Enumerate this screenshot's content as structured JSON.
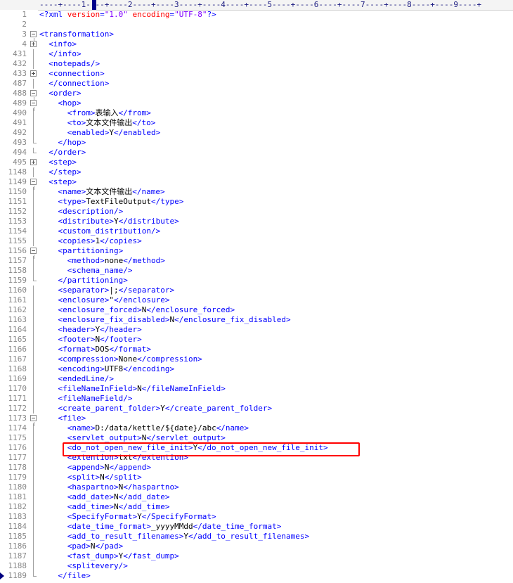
{
  "ruler": {
    "text": "----+----1----+----2----+----3----+----4----+----5----+----6----+----7----+----8----+----9----+"
  },
  "lines": [
    {
      "n": "1",
      "fold": "none",
      "indent": "",
      "tokens": [
        {
          "c": "t",
          "s": "<?xml "
        },
        {
          "c": "a",
          "s": "version"
        },
        {
          "c": "t",
          "s": "="
        },
        {
          "c": "v",
          "s": "\"1.0\""
        },
        {
          "c": "t",
          "s": " "
        },
        {
          "c": "a",
          "s": "encoding"
        },
        {
          "c": "t",
          "s": "="
        },
        {
          "c": "v",
          "s": "\"UTF-8\""
        },
        {
          "c": "t",
          "s": "?>"
        }
      ]
    },
    {
      "n": "2",
      "fold": "none",
      "indent": "",
      "tokens": []
    },
    {
      "n": "3",
      "fold": "minus",
      "indent": "",
      "tokens": [
        {
          "c": "t",
          "s": "<transformation>"
        }
      ]
    },
    {
      "n": "4",
      "fold": "plus",
      "indent": "  ",
      "tokens": [
        {
          "c": "t",
          "s": "<info>"
        }
      ]
    },
    {
      "n": "431",
      "fold": "vline",
      "indent": "  ",
      "tokens": [
        {
          "c": "t",
          "s": "</info>"
        }
      ]
    },
    {
      "n": "432",
      "fold": "vline",
      "indent": "  ",
      "tokens": [
        {
          "c": "t",
          "s": "<notepads/>"
        }
      ]
    },
    {
      "n": "433",
      "fold": "plus",
      "indent": "  ",
      "tokens": [
        {
          "c": "t",
          "s": "<connection>"
        }
      ]
    },
    {
      "n": "487",
      "fold": "vline",
      "indent": "  ",
      "tokens": [
        {
          "c": "t",
          "s": "</connection>"
        }
      ]
    },
    {
      "n": "488",
      "fold": "minus",
      "indent": "  ",
      "tokens": [
        {
          "c": "t",
          "s": "<order>"
        }
      ]
    },
    {
      "n": "489",
      "fold": "minus",
      "indent": "    ",
      "tokens": [
        {
          "c": "t",
          "s": "<hop>"
        }
      ]
    },
    {
      "n": "490",
      "fold": "vline",
      "indent": "      ",
      "tokens": [
        {
          "c": "t",
          "s": "<from>"
        },
        {
          "c": "x",
          "s": "表输入"
        },
        {
          "c": "t",
          "s": "</from>"
        }
      ]
    },
    {
      "n": "491",
      "fold": "vline",
      "indent": "      ",
      "tokens": [
        {
          "c": "t",
          "s": "<to>"
        },
        {
          "c": "x",
          "s": "文本文件输出"
        },
        {
          "c": "t",
          "s": "</to>"
        }
      ]
    },
    {
      "n": "492",
      "fold": "vline",
      "indent": "      ",
      "tokens": [
        {
          "c": "t",
          "s": "<enabled>"
        },
        {
          "c": "x",
          "s": "Y"
        },
        {
          "c": "t",
          "s": "</enabled>"
        }
      ]
    },
    {
      "n": "493",
      "fold": "end",
      "indent": "    ",
      "tokens": [
        {
          "c": "t",
          "s": "</hop>"
        }
      ]
    },
    {
      "n": "494",
      "fold": "end",
      "indent": "  ",
      "tokens": [
        {
          "c": "t",
          "s": "</order>"
        }
      ]
    },
    {
      "n": "495",
      "fold": "plus",
      "indent": "  ",
      "tokens": [
        {
          "c": "t",
          "s": "<step>"
        }
      ]
    },
    {
      "n": "1148",
      "fold": "vline",
      "indent": "  ",
      "tokens": [
        {
          "c": "t",
          "s": "</step>"
        }
      ]
    },
    {
      "n": "1149",
      "fold": "minus",
      "indent": "  ",
      "tokens": [
        {
          "c": "t",
          "s": "<step>"
        }
      ]
    },
    {
      "n": "1150",
      "fold": "vline",
      "indent": "    ",
      "tokens": [
        {
          "c": "t",
          "s": "<name>"
        },
        {
          "c": "x",
          "s": "文本文件输出"
        },
        {
          "c": "t",
          "s": "</name>"
        }
      ]
    },
    {
      "n": "1151",
      "fold": "vline",
      "indent": "    ",
      "tokens": [
        {
          "c": "t",
          "s": "<type>"
        },
        {
          "c": "x",
          "s": "TextFileOutput"
        },
        {
          "c": "t",
          "s": "</type>"
        }
      ]
    },
    {
      "n": "1152",
      "fold": "vline",
      "indent": "    ",
      "tokens": [
        {
          "c": "t",
          "s": "<description/>"
        }
      ]
    },
    {
      "n": "1153",
      "fold": "vline",
      "indent": "    ",
      "tokens": [
        {
          "c": "t",
          "s": "<distribute>"
        },
        {
          "c": "x",
          "s": "Y"
        },
        {
          "c": "t",
          "s": "</distribute>"
        }
      ]
    },
    {
      "n": "1154",
      "fold": "vline",
      "indent": "    ",
      "tokens": [
        {
          "c": "t",
          "s": "<custom_distribution/>"
        }
      ]
    },
    {
      "n": "1155",
      "fold": "vline",
      "indent": "    ",
      "tokens": [
        {
          "c": "t",
          "s": "<copies>"
        },
        {
          "c": "x",
          "s": "1"
        },
        {
          "c": "t",
          "s": "</copies>"
        }
      ]
    },
    {
      "n": "1156",
      "fold": "minus",
      "indent": "    ",
      "tokens": [
        {
          "c": "t",
          "s": "<partitioning>"
        }
      ]
    },
    {
      "n": "1157",
      "fold": "vline",
      "indent": "      ",
      "tokens": [
        {
          "c": "t",
          "s": "<method>"
        },
        {
          "c": "x",
          "s": "none"
        },
        {
          "c": "t",
          "s": "</method>"
        }
      ]
    },
    {
      "n": "1158",
      "fold": "vline",
      "indent": "      ",
      "tokens": [
        {
          "c": "t",
          "s": "<schema_name/>"
        }
      ]
    },
    {
      "n": "1159",
      "fold": "end",
      "indent": "    ",
      "tokens": [
        {
          "c": "t",
          "s": "</partitioning>"
        }
      ]
    },
    {
      "n": "1160",
      "fold": "vline",
      "indent": "    ",
      "tokens": [
        {
          "c": "t",
          "s": "<separator>"
        },
        {
          "c": "x",
          "s": "|;"
        },
        {
          "c": "t",
          "s": "</separator>"
        }
      ]
    },
    {
      "n": "1161",
      "fold": "vline",
      "indent": "    ",
      "tokens": [
        {
          "c": "t",
          "s": "<enclosure>"
        },
        {
          "c": "x",
          "s": "\""
        },
        {
          "c": "t",
          "s": "</enclosure>"
        }
      ]
    },
    {
      "n": "1162",
      "fold": "vline",
      "indent": "    ",
      "tokens": [
        {
          "c": "t",
          "s": "<enclosure_forced>"
        },
        {
          "c": "x",
          "s": "N"
        },
        {
          "c": "t",
          "s": "</enclosure_forced>"
        }
      ]
    },
    {
      "n": "1163",
      "fold": "vline",
      "indent": "    ",
      "tokens": [
        {
          "c": "t",
          "s": "<enclosure_fix_disabled>"
        },
        {
          "c": "x",
          "s": "N"
        },
        {
          "c": "t",
          "s": "</enclosure_fix_disabled>"
        }
      ]
    },
    {
      "n": "1164",
      "fold": "vline",
      "indent": "    ",
      "tokens": [
        {
          "c": "t",
          "s": "<header>"
        },
        {
          "c": "x",
          "s": "Y"
        },
        {
          "c": "t",
          "s": "</header>"
        }
      ]
    },
    {
      "n": "1165",
      "fold": "vline",
      "indent": "    ",
      "tokens": [
        {
          "c": "t",
          "s": "<footer>"
        },
        {
          "c": "x",
          "s": "N"
        },
        {
          "c": "t",
          "s": "</footer>"
        }
      ]
    },
    {
      "n": "1166",
      "fold": "vline",
      "indent": "    ",
      "tokens": [
        {
          "c": "t",
          "s": "<format>"
        },
        {
          "c": "x",
          "s": "DOS"
        },
        {
          "c": "t",
          "s": "</format>"
        }
      ]
    },
    {
      "n": "1167",
      "fold": "vline",
      "indent": "    ",
      "tokens": [
        {
          "c": "t",
          "s": "<compression>"
        },
        {
          "c": "x",
          "s": "None"
        },
        {
          "c": "t",
          "s": "</compression>"
        }
      ]
    },
    {
      "n": "1168",
      "fold": "vline",
      "indent": "    ",
      "tokens": [
        {
          "c": "t",
          "s": "<encoding>"
        },
        {
          "c": "x",
          "s": "UTF8"
        },
        {
          "c": "t",
          "s": "</encoding>"
        }
      ]
    },
    {
      "n": "1169",
      "fold": "vline",
      "indent": "    ",
      "tokens": [
        {
          "c": "t",
          "s": "<endedLine/>"
        }
      ]
    },
    {
      "n": "1170",
      "fold": "vline",
      "indent": "    ",
      "tokens": [
        {
          "c": "t",
          "s": "<fileNameInField>"
        },
        {
          "c": "x",
          "s": "N"
        },
        {
          "c": "t",
          "s": "</fileNameInField>"
        }
      ]
    },
    {
      "n": "1171",
      "fold": "vline",
      "indent": "    ",
      "tokens": [
        {
          "c": "t",
          "s": "<fileNameField/>"
        }
      ]
    },
    {
      "n": "1172",
      "fold": "vline",
      "indent": "    ",
      "tokens": [
        {
          "c": "t",
          "s": "<create_parent_folder>"
        },
        {
          "c": "x",
          "s": "Y"
        },
        {
          "c": "t",
          "s": "</create_parent_folder>"
        }
      ]
    },
    {
      "n": "1173",
      "fold": "minus",
      "indent": "    ",
      "tokens": [
        {
          "c": "t",
          "s": "<file>"
        }
      ]
    },
    {
      "n": "1174",
      "fold": "vline",
      "indent": "      ",
      "tokens": [
        {
          "c": "t",
          "s": "<name>"
        },
        {
          "c": "x",
          "s": "D:/data/kettle/${date}/abc"
        },
        {
          "c": "t",
          "s": "</name>"
        }
      ]
    },
    {
      "n": "1175",
      "fold": "vline",
      "indent": "      ",
      "tokens": [
        {
          "c": "t",
          "s": "<servlet_output>"
        },
        {
          "c": "x",
          "s": "N"
        },
        {
          "c": "t",
          "s": "</servlet_output>"
        }
      ]
    },
    {
      "n": "1176",
      "fold": "vline",
      "indent": "      ",
      "tokens": [
        {
          "c": "t",
          "s": "<do_not_open_new_file_init>"
        },
        {
          "c": "x",
          "s": "Y"
        },
        {
          "c": "t",
          "s": "</do_not_open_new_file_init>"
        }
      ]
    },
    {
      "n": "1177",
      "fold": "vline",
      "indent": "      ",
      "tokens": [
        {
          "c": "t",
          "s": "<extention>"
        },
        {
          "c": "x",
          "s": "txt"
        },
        {
          "c": "t",
          "s": "</extention>"
        }
      ]
    },
    {
      "n": "1178",
      "fold": "vline",
      "indent": "      ",
      "tokens": [
        {
          "c": "t",
          "s": "<append>"
        },
        {
          "c": "x",
          "s": "N"
        },
        {
          "c": "t",
          "s": "</append>"
        }
      ]
    },
    {
      "n": "1179",
      "fold": "vline",
      "indent": "      ",
      "tokens": [
        {
          "c": "t",
          "s": "<split>"
        },
        {
          "c": "x",
          "s": "N"
        },
        {
          "c": "t",
          "s": "</split>"
        }
      ]
    },
    {
      "n": "1180",
      "fold": "vline",
      "indent": "      ",
      "tokens": [
        {
          "c": "t",
          "s": "<haspartno>"
        },
        {
          "c": "x",
          "s": "N"
        },
        {
          "c": "t",
          "s": "</haspartno>"
        }
      ]
    },
    {
      "n": "1181",
      "fold": "vline",
      "indent": "      ",
      "tokens": [
        {
          "c": "t",
          "s": "<add_date>"
        },
        {
          "c": "x",
          "s": "N"
        },
        {
          "c": "t",
          "s": "</add_date>"
        }
      ]
    },
    {
      "n": "1182",
      "fold": "vline",
      "indent": "      ",
      "tokens": [
        {
          "c": "t",
          "s": "<add_time>"
        },
        {
          "c": "x",
          "s": "N"
        },
        {
          "c": "t",
          "s": "</add_time>"
        }
      ]
    },
    {
      "n": "1183",
      "fold": "vline",
      "indent": "      ",
      "tokens": [
        {
          "c": "t",
          "s": "<SpecifyFormat>"
        },
        {
          "c": "x",
          "s": "Y"
        },
        {
          "c": "t",
          "s": "</SpecifyFormat>"
        }
      ]
    },
    {
      "n": "1184",
      "fold": "vline",
      "indent": "      ",
      "tokens": [
        {
          "c": "t",
          "s": "<date_time_format>"
        },
        {
          "c": "x",
          "s": "_yyyyMMdd"
        },
        {
          "c": "t",
          "s": "</date_time_format>"
        }
      ]
    },
    {
      "n": "1185",
      "fold": "vline",
      "indent": "      ",
      "tokens": [
        {
          "c": "t",
          "s": "<add_to_result_filenames>"
        },
        {
          "c": "x",
          "s": "Y"
        },
        {
          "c": "t",
          "s": "</add_to_result_filenames>"
        }
      ]
    },
    {
      "n": "1186",
      "fold": "vline",
      "indent": "      ",
      "tokens": [
        {
          "c": "t",
          "s": "<pad>"
        },
        {
          "c": "x",
          "s": "N"
        },
        {
          "c": "t",
          "s": "</pad>"
        }
      ]
    },
    {
      "n": "1187",
      "fold": "vline",
      "indent": "      ",
      "tokens": [
        {
          "c": "t",
          "s": "<fast_dump>"
        },
        {
          "c": "x",
          "s": "Y"
        },
        {
          "c": "t",
          "s": "</fast_dump>"
        }
      ]
    },
    {
      "n": "1188",
      "fold": "vline",
      "indent": "      ",
      "tokens": [
        {
          "c": "t",
          "s": "<splitevery/>"
        }
      ]
    },
    {
      "n": "1189",
      "fold": "end",
      "indent": "    ",
      "tokens": [
        {
          "c": "t",
          "s": "</file>"
        }
      ],
      "current": true
    }
  ],
  "colors": {
    "tag": "#0000ff",
    "attr": "#ff0000",
    "string": "#8000ff",
    "text": "#000000",
    "highlight": "#ff0000"
  }
}
